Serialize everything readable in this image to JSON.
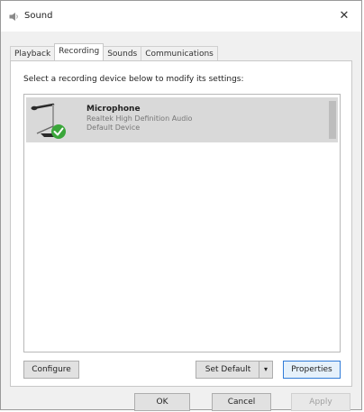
{
  "window": {
    "title": "Sound",
    "close_glyph": "✕"
  },
  "tabs": [
    {
      "label": "Playback",
      "active": false
    },
    {
      "label": "Recording",
      "active": true
    },
    {
      "label": "Sounds",
      "active": false
    },
    {
      "label": "Communications",
      "active": false
    }
  ],
  "panel": {
    "instruction": "Select a recording device below to modify its settings:"
  },
  "devices": [
    {
      "name": "Microphone",
      "driver": "Realtek High Definition Audio",
      "status": "Default Device",
      "selected": true,
      "status_icon": "green-check-icon"
    }
  ],
  "buttons": {
    "configure": "Configure",
    "set_default": "Set Default",
    "set_default_arrow": "▾",
    "properties": "Properties",
    "ok": "OK",
    "cancel": "Cancel",
    "apply": "Apply"
  },
  "colors": {
    "selection": "#d9d9d9",
    "accent_border": "#2f7bd8",
    "check_green": "#3aa63a"
  }
}
